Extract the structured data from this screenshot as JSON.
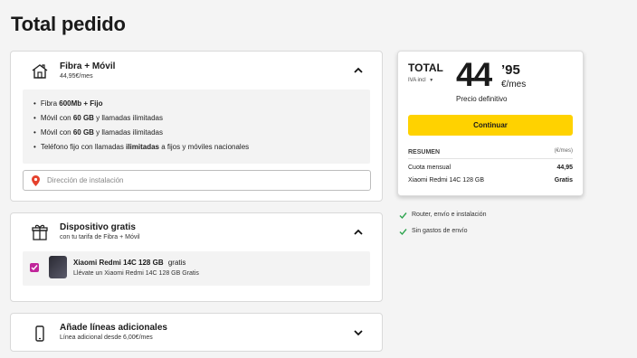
{
  "page": {
    "title": "Total pedido"
  },
  "colors": {
    "accent": "#ffd200",
    "check": "#2ea44f",
    "checkbox": "#c0259a",
    "pin": "#e5412d"
  },
  "card_fibra": {
    "title": "Fibra + Móvil",
    "price": "44,95€/mes",
    "icon": "house-icon",
    "features": [
      {
        "pre": "Fibra ",
        "bold": "600Mb + Fijo",
        "post": ""
      },
      {
        "pre": "Móvil con ",
        "bold": "60 GB",
        "post": " y llamadas ilimitadas"
      },
      {
        "pre": "Móvil con ",
        "bold": "60 GB",
        "post": " y llamadas ilimitadas"
      },
      {
        "pre": "Teléfono fijo con llamadas ",
        "bold": "ilimitadas",
        "post": " a fijos y móviles nacionales"
      }
    ],
    "address_placeholder": "Dirección de instalación"
  },
  "card_device": {
    "title": "Dispositivo gratis",
    "subtitle": "con tu tarifa de Fibra + Móvil",
    "icon": "gift-icon",
    "device_name": "Xiaomi Redmi 14C 128 GB",
    "device_tag": "gratis",
    "device_desc": "Llévate un Xiaomi Redmi 14C 128 GB Gratis",
    "checked": true
  },
  "card_lines": {
    "title": "Añade líneas adicionales",
    "subtitle": "Línea adicional desde 6,00€/mes",
    "icon": "mobile-phone-icon"
  },
  "summary": {
    "total_label": "TOTAL",
    "iva_label": "IVA incl",
    "price_int": "44",
    "price_dec": "’95",
    "price_unit": "€/mes",
    "price_note": "Precio definitivo",
    "cta": "Continuar",
    "resumen_label": "RESUMEN",
    "resumen_unit": "(€/mes)",
    "rows": [
      {
        "label": "Cuota mensual",
        "value": "44,95"
      },
      {
        "label": "Xiaomi Redmi 14C 128 GB",
        "value": "Gratis"
      }
    ]
  },
  "benefits": [
    "Router, envío e instalación",
    "Sin gastos de envío"
  ]
}
